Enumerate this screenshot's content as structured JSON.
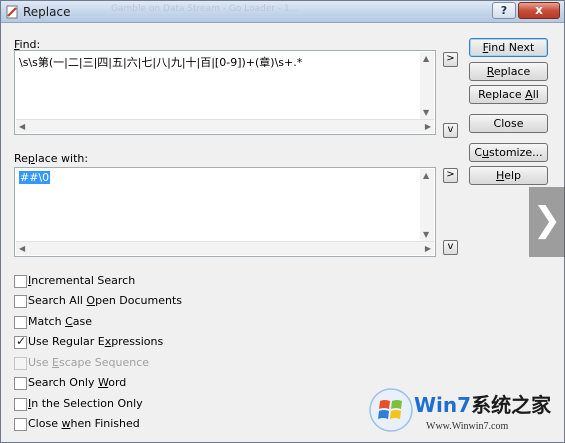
{
  "window": {
    "title": "Replace",
    "title_ghost": "Gamble on Data Stream - Go Loader - 1...",
    "help_label": "?",
    "close_label": "x"
  },
  "find": {
    "label_pre": "",
    "label_underline": "F",
    "label_post": "ind:",
    "value": "\\s\\s第(一|二|三|四|五|六|七|八|九|十|百|[0-9])+(章)\\s+.*",
    "history_button": ">",
    "expand_button": "v"
  },
  "replace": {
    "label_pre": "Re",
    "label_underline": "p",
    "label_post": "lace with:",
    "value": "##\\0",
    "history_button": ">",
    "expand_button": "v"
  },
  "buttons": {
    "find_next": {
      "pre": "",
      "u": "F",
      "post": "ind Next"
    },
    "replace": {
      "pre": "",
      "u": "R",
      "post": "eplace"
    },
    "replace_all": {
      "pre": "Replace ",
      "u": "A",
      "post": "ll"
    },
    "close": {
      "pre": "",
      "u": "",
      "post": "Close"
    },
    "customize": {
      "pre": "C",
      "u": "u",
      "post": "stomize..."
    },
    "help": {
      "pre": "",
      "u": "H",
      "post": "elp"
    }
  },
  "options": [
    {
      "pre": "",
      "u": "I",
      "post": "ncremental Search",
      "checked": false,
      "disabled": false
    },
    {
      "pre": "Search All ",
      "u": "O",
      "post": "pen Documents",
      "checked": false,
      "disabled": false
    },
    {
      "pre": "Match ",
      "u": "C",
      "post": "ase",
      "checked": false,
      "disabled": false
    },
    {
      "pre": "Use Regular E",
      "u": "x",
      "post": "pressions",
      "checked": true,
      "disabled": false
    },
    {
      "pre": "Use ",
      "u": "E",
      "post": "scape Sequence",
      "checked": false,
      "disabled": true
    },
    {
      "pre": "Search Only ",
      "u": "W",
      "post": "ord",
      "checked": false,
      "disabled": false
    },
    {
      "pre": "",
      "u": "I",
      "post": "n the Selection Only",
      "checked": false,
      "disabled": false
    },
    {
      "pre": "Close ",
      "u": "w",
      "post": "hen Finished",
      "checked": false,
      "disabled": false
    }
  ],
  "overlay": {
    "next_arrow": "❯"
  },
  "watermark": {
    "brand_blue": "Win7",
    "brand_cn": "系统之家",
    "url": "Www.Winwin7.com"
  },
  "colors": {
    "selection": "#3399ff",
    "default_button_border": "#3c7fb1",
    "close_button": "#c7503b"
  }
}
